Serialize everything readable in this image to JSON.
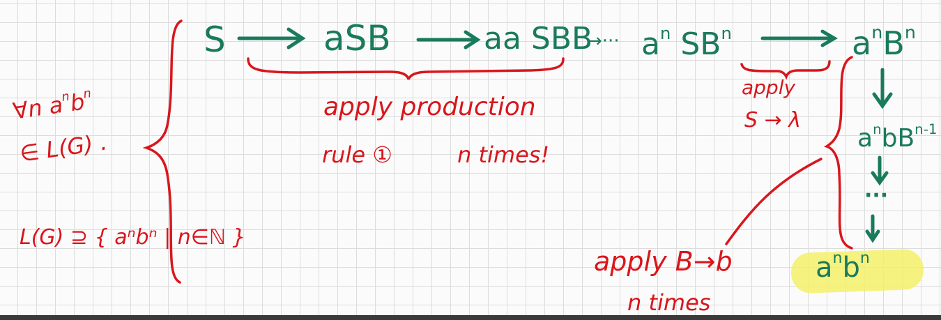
{
  "chain": {
    "s": "S",
    "asb": "aSB",
    "aasbb": "aa SBB",
    "dots": "→···",
    "an_sbn_a": "a",
    "an_sbn_n1": "n",
    "an_sbn_sb": "SB",
    "an_sbn_n2": "n",
    "anbn_a": "a",
    "anbn_n1": "n",
    "anbn_b": "B",
    "anbn_n2": "n"
  },
  "vertical": {
    "step1_a": "a",
    "step1_n": "n",
    "step1_bb": "bB",
    "step1_exp": "n-1",
    "dots": "···",
    "final_a": "a",
    "final_n1": "n",
    "final_b": "b",
    "final_n2": "n"
  },
  "notes": {
    "apply_production_1": "apply production",
    "apply_production_2": "rule ①",
    "n_times": "n times!",
    "apply_lambda_1": "apply",
    "apply_lambda_2": "S → λ",
    "apply_b_1": "apply B→b",
    "apply_b_2": "n times",
    "forall_1": "∀n a",
    "forall_n": "n",
    "forall_b": "b",
    "forall_n2": "n",
    "forall_2": "∈ L(G) .",
    "language": "L(G) ⊇ { aⁿbⁿ | n∈ℕ }"
  },
  "colors": {
    "green": "#1a7a5c",
    "red": "#d9161c",
    "highlight": "#f3f06a"
  }
}
